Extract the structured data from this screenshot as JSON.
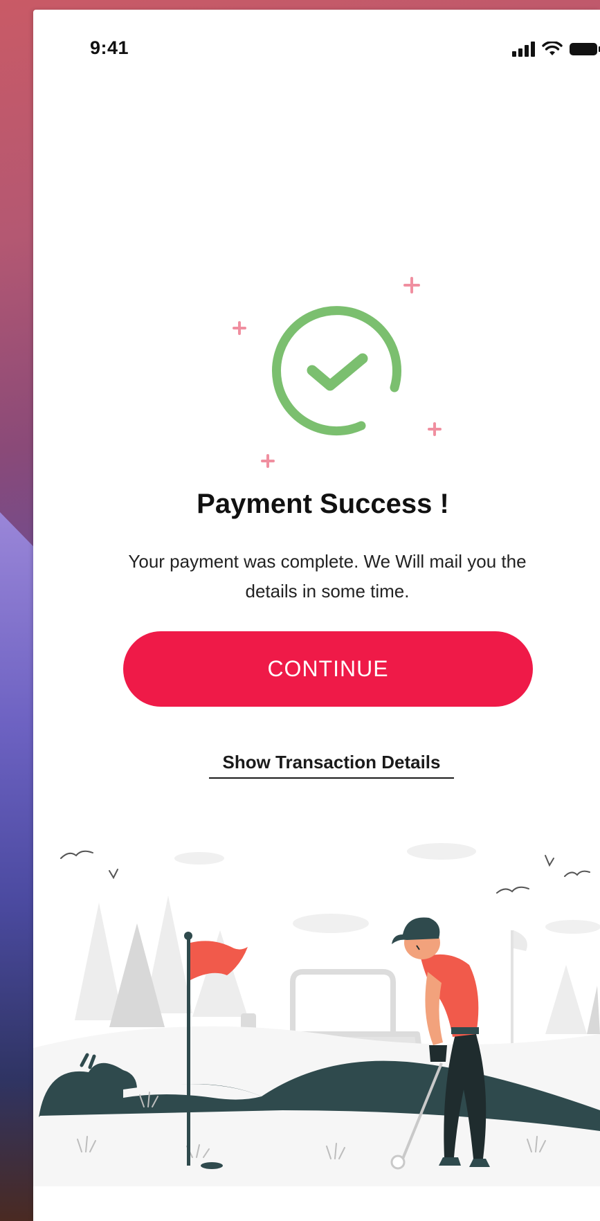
{
  "status_bar": {
    "time": "9:41",
    "icons": [
      "cellular-signal-icon",
      "wifi-icon",
      "battery-icon"
    ]
  },
  "success": {
    "icon": "check-circle-icon",
    "sparkle_icon": "plus-sparkle-icon",
    "title": "Payment Success !",
    "message": "Your payment was complete. We Will mail you the details in some time."
  },
  "actions": {
    "continue_label": "CONTINUE",
    "details_link_label": "Show Transaction Details"
  },
  "illustration": {
    "icon": "golfer-illustration"
  },
  "colors": {
    "accent": "#ef1a48",
    "success_green": "#7bbf6f",
    "sparkle_pink": "#f08fa0",
    "hill_dark": "#2f4a4d",
    "shirt_red": "#f15a4b"
  }
}
